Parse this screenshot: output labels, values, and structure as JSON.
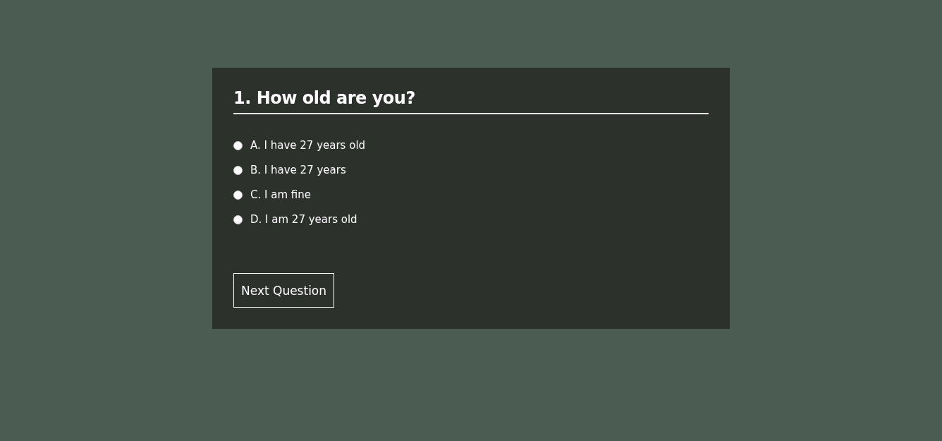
{
  "question": {
    "title": "1. How old are you?"
  },
  "options": [
    {
      "label": "A. I have 27 years old",
      "selected": false
    },
    {
      "label": "B. I have 27 years",
      "selected": false
    },
    {
      "label": "C. I am fine",
      "selected": false
    },
    {
      "label": "D. I am 27 years old",
      "selected": false
    }
  ],
  "button": {
    "label": "Next Question"
  }
}
